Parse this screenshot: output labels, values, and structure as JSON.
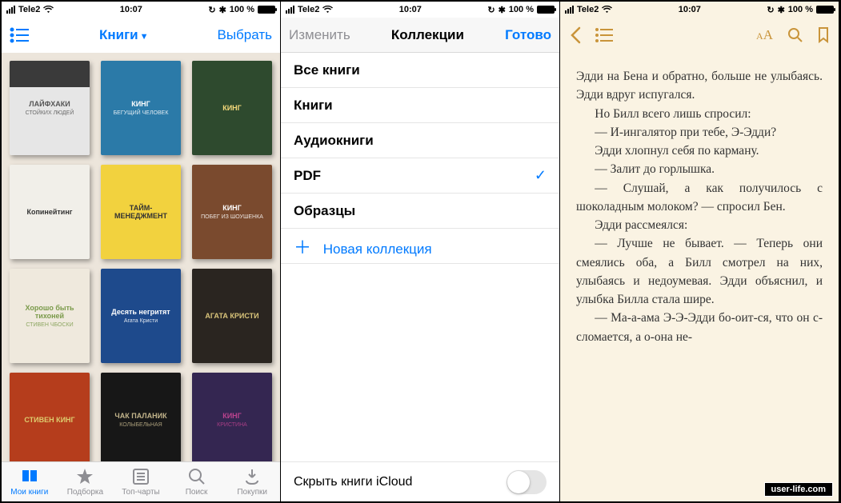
{
  "status": {
    "carrier": "Tele2",
    "time": "10:07",
    "battery": "100 %"
  },
  "screen1": {
    "nav": {
      "title": "Книги",
      "select": "Выбрать"
    },
    "books": [
      {
        "title": "ЛАЙФХАКИ",
        "sub": "СТОЙКИХ ЛЮДЕЙ",
        "bg": "#3a3a3a",
        "bg2": "#e6e6e6",
        "tc": "#555"
      },
      {
        "title": "КИНГ",
        "sub": "БЕГУЩИЙ ЧЕЛОВЕК",
        "bg": "#2b7aa8",
        "tc": "#fff"
      },
      {
        "title": "КИНГ",
        "sub": "",
        "bg": "#2e4a2e",
        "tc": "#f5d97b"
      },
      {
        "title": "Копинейтинг",
        "sub": "",
        "bg": "#f1efe9",
        "tc": "#333"
      },
      {
        "title": "ТАЙМ-МЕНЕДЖМЕНТ",
        "sub": "",
        "bg": "#f2d23e",
        "tc": "#333"
      },
      {
        "title": "КИНГ",
        "sub": "ПОБЕГ ИЗ ШОУШЕНКА",
        "bg": "#7a4a2e",
        "tc": "#fff"
      },
      {
        "title": "Хорошо быть тихоней",
        "sub": "СТИВЕН ЧБОСКИ",
        "bg": "#efe9dd",
        "tc": "#7a9a4a"
      },
      {
        "title": "Десять негритят",
        "sub": "Агата Кристи",
        "bg": "#1e4a8c",
        "tc": "#fff"
      },
      {
        "title": "АГАТА КРИСТИ",
        "sub": "",
        "bg": "#2a2520",
        "tc": "#d9c47a"
      },
      {
        "title": "СТИВЕН КИНГ",
        "sub": "",
        "bg": "#c9441f",
        "tc": "#f5e27a"
      },
      {
        "title": "ЧАК ПАЛАНИК",
        "sub": "КОЛЫБЕЛЬНАЯ",
        "bg": "#1a1a1a",
        "tc": "#d8c89a"
      },
      {
        "title": "КИНГ",
        "sub": "КРИСТИНА",
        "bg": "#3a2a5a",
        "tc": "#d04a9e"
      }
    ],
    "tabs": [
      {
        "label": "Мои книги",
        "active": true
      },
      {
        "label": "Подборка",
        "active": false
      },
      {
        "label": "Топ-чарты",
        "active": false
      },
      {
        "label": "Поиск",
        "active": false
      },
      {
        "label": "Покупки",
        "active": false
      }
    ]
  },
  "screen2": {
    "nav": {
      "edit": "Изменить",
      "title": "Коллекции",
      "done": "Готово"
    },
    "rows": [
      {
        "label": "Все книги",
        "checked": false
      },
      {
        "label": "Книги",
        "checked": false
      },
      {
        "label": "Аудиокниги",
        "checked": false
      },
      {
        "label": "PDF",
        "checked": true
      },
      {
        "label": "Образцы",
        "checked": false
      }
    ],
    "new": "Новая коллекция",
    "footer": "Скрыть книги iCloud"
  },
  "screen3": {
    "lines": [
      {
        "t": "Эдди на Бена и обратно, больше не улыбаясь. Эдди вдруг испугался.",
        "i": false
      },
      {
        "t": "Но Билл всего лишь спросил:",
        "i": true
      },
      {
        "t": "— И-ингалятор при тебе, Э-Эдди?",
        "i": true
      },
      {
        "t": "Эдди хлопнул себя по карману.",
        "i": true
      },
      {
        "t": "— Залит до горлышка.",
        "i": true
      },
      {
        "t": "— Слушай, а как получилось с шоколадным молоком? — спросил Бен.",
        "i": true
      },
      {
        "t": "Эдди рассмеялся:",
        "i": true
      },
      {
        "t": "— Лучше не бывает. — Теперь они смеялись оба, а Билл смотрел на них, улыбаясь и недоумевая. Эдди объяснил, и улыбка Билла стала шире.",
        "i": true
      },
      {
        "t": "— Ма-а-ама Э-Э-Эдди бо-оит-ся, что он с-сломается, а о-она не-",
        "i": true
      }
    ]
  },
  "watermark": "user-life.com"
}
